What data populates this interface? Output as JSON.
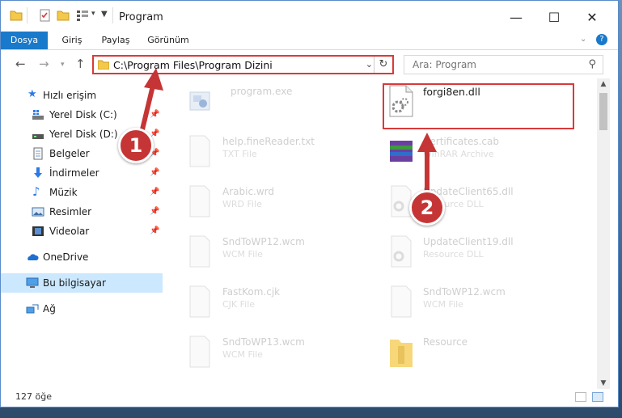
{
  "window": {
    "title": "Program",
    "controls": {
      "minimize": "—",
      "maximize": "☐",
      "close": "✕"
    }
  },
  "ribbon": {
    "tabs": [
      "Dosya",
      "Giriş",
      "Paylaş",
      "Görünüm"
    ],
    "help_icon": "?"
  },
  "address_bar": {
    "path": "C:\\Program Files\\Program Dizini",
    "search_placeholder": "Ara: Program"
  },
  "sidebar": {
    "quick_access": "Hızlı erişim",
    "items": [
      {
        "label": "Yerel Disk (C:)",
        "icon": "drive-icon",
        "pinned": true
      },
      {
        "label": "Yerel Disk (D:)",
        "icon": "drive-icon",
        "pinned": true
      },
      {
        "label": "Belgeler",
        "icon": "documents-icon",
        "pinned": true
      },
      {
        "label": "İndirmeler",
        "icon": "download-icon",
        "pinned": true
      },
      {
        "label": "Müzik",
        "icon": "music-icon",
        "pinned": true
      },
      {
        "label": "Resimler",
        "icon": "pictures-icon",
        "pinned": true
      },
      {
        "label": "Videolar",
        "icon": "video-icon",
        "pinned": true
      }
    ],
    "onedrive": "OneDrive",
    "this_pc": "Bu bilgisayar",
    "network": "Ağ"
  },
  "files": [
    {
      "name": "program.exe",
      "type": ""
    },
    {
      "name": "forgi8en.dll",
      "type": ""
    },
    {
      "name": "help.fineReader.txt",
      "type": "TXT File"
    },
    {
      "name": "Certificates.cab",
      "type": "WinRAR Archive"
    },
    {
      "name": "Arabic.wrd",
      "type": "WRD File"
    },
    {
      "name": "UpdateClient65.dll",
      "type": "Resource DLL"
    },
    {
      "name": "SndToWP12.wcm",
      "type": "WCM File"
    },
    {
      "name": "UpdateClient19.dll",
      "type": "Resource DLL"
    },
    {
      "name": "FastKom.cjk",
      "type": "CJK File"
    },
    {
      "name": "SndToWP12.wcm",
      "type": "WCM File"
    },
    {
      "name": "SndToWP13.wcm",
      "type": "WCM File"
    },
    {
      "name": "Resource",
      "type": ""
    }
  ],
  "status": {
    "item_count": "127 öğe"
  },
  "annotations": {
    "step1": "1",
    "step2": "2"
  },
  "colors": {
    "accent": "#1979ca",
    "highlight": "#d93a3a",
    "selected": "#cce8ff"
  }
}
